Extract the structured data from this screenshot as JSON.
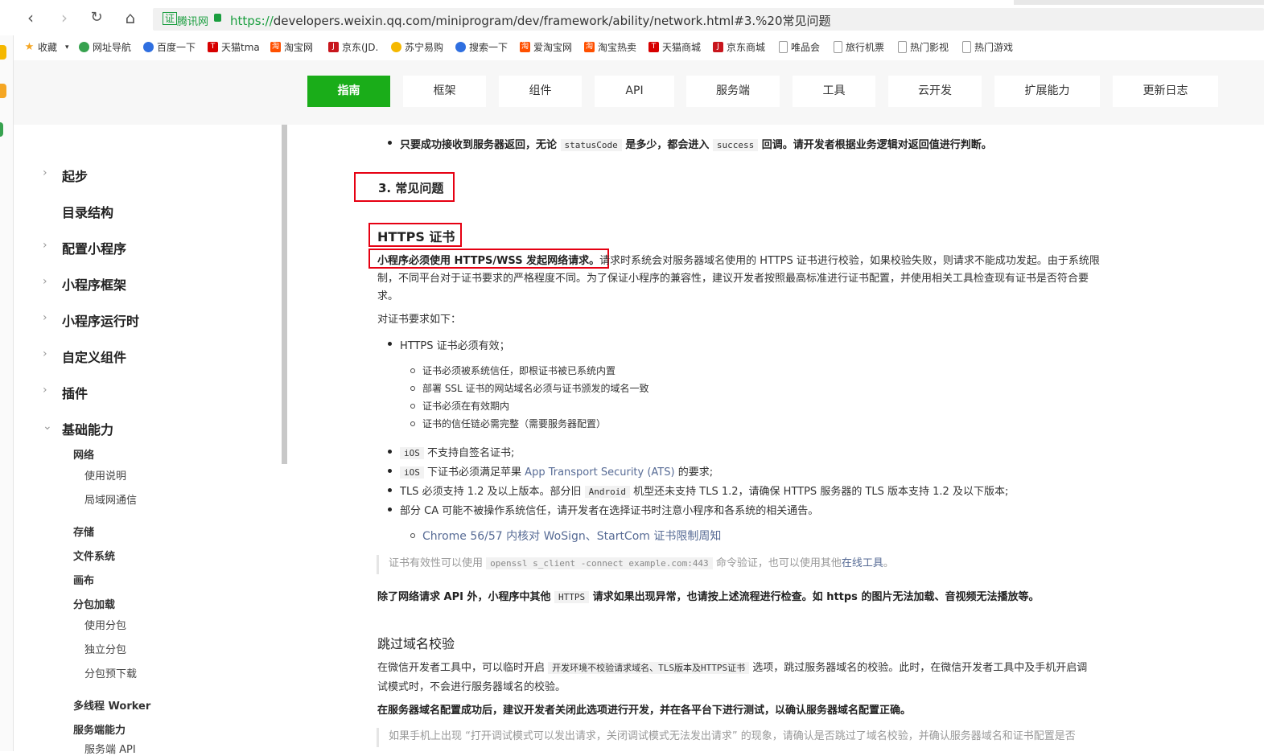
{
  "browser": {
    "url_scheme": "https://",
    "url_rest": "developers.weixin.qq.com/miniprogram/dev/framework/ability/network.html#3.%20常见问题",
    "cert_badge": "证",
    "cert_label": "腾讯网",
    "bookmarks": [
      "收藏",
      "网址导航",
      "百度一下",
      "天猫tma",
      "淘宝网",
      "京东(JD.",
      "苏宁易购",
      "搜索一下",
      "爱淘宝网",
      "淘宝热卖",
      "天猫商城",
      "京东商城",
      "唯品会",
      "旅行机票",
      "热门影视",
      "热门游戏"
    ]
  },
  "topnav": {
    "items": [
      "指南",
      "框架",
      "组件",
      "API",
      "服务端",
      "工具",
      "云开发",
      "扩展能力",
      "更新日志"
    ],
    "active": "指南"
  },
  "sidebar": {
    "level1": [
      "起步",
      "目录结构",
      "配置小程序",
      "小程序框架",
      "小程序运行时",
      "自定义组件",
      "插件",
      "基础能力"
    ],
    "network": "网络",
    "network_items": [
      "使用说明",
      "局域网通信"
    ],
    "storage": "存储",
    "filesystem": "文件系统",
    "canvas": "画布",
    "subpackage": "分包加载",
    "subpackage_items": [
      "使用分包",
      "独立分包",
      "分包预下载"
    ],
    "worker": "多线程 Worker",
    "server": "服务端能力",
    "server_item": "服务端 API"
  },
  "content": {
    "top_note_a": "只要成功接收到服务器返回，无论",
    "top_note_code1": "statusCode",
    "top_note_b": "是多少，都会进入",
    "top_note_code2": "success",
    "top_note_c": "回调。请开发者根据业务逻辑对返回值进行判断。",
    "section_title": "3. 常见问题",
    "https_title": "HTTPS 证书",
    "p1_bold": "小程序必须使用 HTTPS/WSS 发起网络请求。",
    "p1_line1": "请求时系统会对服务器域名使用的 HTTPS 证书进行校验，如果校验失败，则请求不能成功发起。由于系统限",
    "p1_line2": "制，不同平台对于证书要求的严格程度不同。为了保证小程序的兼容性，建议开发者按照最高标准进行证书配置，并使用相关工具检查现有证书是否符合要",
    "p1_line3": "求。",
    "cert_req": "对证书要求如下：",
    "b1": "HTTPS 证书必须有效；",
    "sub": [
      "证书必须被系统信任，即根证书被已系统内置",
      "部署 SSL 证书的网站域名必须与证书颁发的域名一致",
      "证书必须在有效期内",
      "证书的信任链必需完整（需要服务器配置）"
    ],
    "b2_code": "iOS",
    "b2": "不支持自签名证书;",
    "b3_code": "iOS",
    "b3_a": "下证书必须满足苹果",
    "b3_link": "App Transport Security (ATS)",
    "b3_b": "的要求;",
    "b4_a": "TLS 必须支持 1.2 及以上版本。部分旧",
    "b4_code": "Android",
    "b4_b": "机型还未支持 TLS 1.2，请确保 HTTPS 服务器的 TLS 版本支持 1.2 及以下版本;",
    "b5": "部分 CA 可能不被操作系统信任，请开发者在选择证书时注意小程序和各系统的相关通告。",
    "b5_link": "Chrome 56/57 内核对 WoSign、StartCom 证书限制周知",
    "quote_a": "证书有效性可以使用",
    "quote_code": "openssl s_client -connect example.com:443",
    "quote_b": "命令验证，也可以使用其他",
    "quote_link": "在线工具",
    "quote_c": "。",
    "p2_a": "除了网络请求 API 外，小程序中其他",
    "p2_code": "HTTPS",
    "p2_b": "请求如果出现异常，也请按上述流程进行检查。如 https 的图片无法加载、音视频无法播放等。",
    "skip_title": "跳过域名校验",
    "p3_a": "在微信开发者工具中，可以临时开启",
    "p3_code": "开发环境不校验请求域名、TLS版本及HTTPS证书",
    "p3_b": "选项，跳过服务器域名的校验。此时，在微信开发者工具中及手机开启调",
    "p3_line2": "试模式时，不会进行服务器域名的校验。",
    "p4": "在服务器域名配置成功后，建议开发者关闭此选项进行开发，并在各平台下进行测试，以确认服务器域名配置正确。",
    "quote2": "如果手机上出现 “打开调试模式可以发出请求，关闭调试模式无法发出请求” 的现象，请确认是否跳过了域名校验，并确认服务器域名和证书配置是否"
  }
}
